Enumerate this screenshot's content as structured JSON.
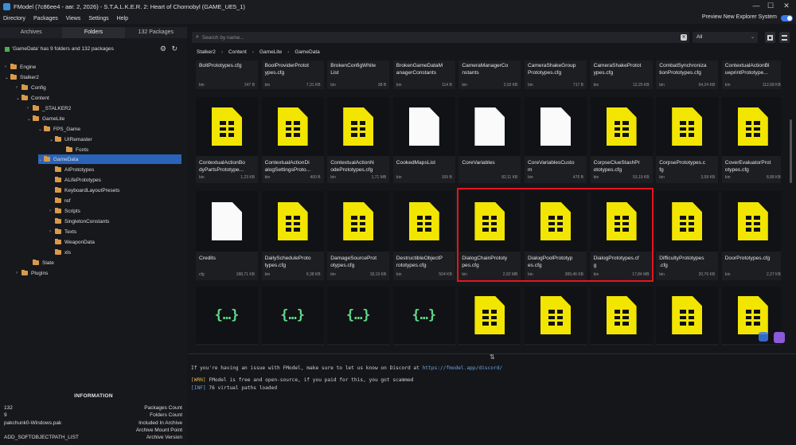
{
  "window": {
    "title": "FModel (7c86ee4 - авг. 2, 2026) - S.T.A.L.K.E.R. 2: Heart of Chornobyl (GAME_UE5_1)",
    "controls": [
      "—",
      "☐",
      "✕"
    ]
  },
  "menu": {
    "items": [
      "Directory",
      "Packages",
      "Views",
      "Settings",
      "Help"
    ],
    "preview_label": "Preview New Explorer System",
    "preview_enabled": true
  },
  "left": {
    "tabs": [
      {
        "label": "Archives",
        "active": false
      },
      {
        "label": "Folders",
        "active": true
      },
      {
        "label": "132 Packages",
        "active": false
      }
    ],
    "status": "'GameData' has 9 folders and 132 packages",
    "tree": [
      {
        "label": "Engine",
        "expanded": false
      },
      {
        "label": "Stalker2",
        "expanded": true
      },
      {
        "label": "Config",
        "expanded": false
      },
      {
        "label": "Content",
        "expanded": true
      },
      {
        "label": "_STALKER2",
        "expanded": false
      },
      {
        "label": "GameLite",
        "expanded": true
      },
      {
        "label": "FPS_Game",
        "expanded": true
      },
      {
        "label": "UIRemaster",
        "expanded": true
      },
      {
        "label": "Fonts",
        "expanded": false
      },
      {
        "label": "GameData",
        "expanded": true,
        "selected": true
      },
      {
        "label": "AIPrototypes",
        "expanded": false
      },
      {
        "label": "ALifePrototypes",
        "expanded": false
      },
      {
        "label": "KeyboardLayoutPresets",
        "expanded": false
      },
      {
        "label": "ref",
        "expanded": false
      },
      {
        "label": "Scripts",
        "expanded": false
      },
      {
        "label": "SingletonConstants",
        "expanded": false
      },
      {
        "label": "Texts",
        "expanded": false
      },
      {
        "label": "WeaponData",
        "expanded": false
      },
      {
        "label": "xls",
        "expanded": false
      },
      {
        "label": "Slate",
        "expanded": false
      },
      {
        "label": "Plugins",
        "expanded": false
      }
    ],
    "information": {
      "title": "INFORMATION",
      "values": [
        "132",
        "9",
        "pakchunk0-Windows.pak",
        "",
        "ADD_SOFTOBJECTPATH_LIST"
      ],
      "labels": [
        "Packages Count",
        "Folders Count",
        "Included In Archive",
        "Archive Mount Point",
        "Archive Version"
      ]
    }
  },
  "search": {
    "placeholder": "Search by name...",
    "filter": "All"
  },
  "breadcrumb": [
    "Stalker2",
    "Content",
    "GameLite",
    "GameData"
  ],
  "files": [
    {
      "name": "BoltPrototypes.cfg",
      "ext": "bin",
      "size": "247 B",
      "icon": "none"
    },
    {
      "name": "BoolProviderProtot\nypes.cfg",
      "ext": "bin",
      "size": "7,31 KB",
      "icon": "none"
    },
    {
      "name": "BrokenConfigWhite\nList",
      "ext": "bin",
      "size": "38 B",
      "icon": "none"
    },
    {
      "name": "BrokenGameDataM\nanagerConstants",
      "ext": "bin",
      "size": "114 B",
      "icon": "none"
    },
    {
      "name": "CameraManagerCo\nnstants",
      "ext": "bin",
      "size": "2,03 KB",
      "icon": "none"
    },
    {
      "name": "CameraShakeGroup\nPrototypes.cfg",
      "ext": "bin",
      "size": "717 B",
      "icon": "none"
    },
    {
      "name": "CameraShakeProtot\nypes.cfg",
      "ext": "bin",
      "size": "12,25 KB",
      "icon": "none"
    },
    {
      "name": "CombatSynchroniza\ntionPrototypes.cfg",
      "ext": "bin",
      "size": "64,24 KB",
      "icon": "none"
    },
    {
      "name": "ContextualActionBl\nueprintPrototype...",
      "ext": "bin",
      "size": "112,68 KB",
      "icon": "none"
    },
    {
      "name": "ContextualActionBo\ndyPartsPrototype...",
      "ext": "bin",
      "size": "1,23 KB",
      "icon": "yellow"
    },
    {
      "name": "ContextualActionDi\nalogSettingsProto...",
      "ext": "bin",
      "size": "400 B",
      "icon": "yellow"
    },
    {
      "name": "ContextualActionN\nodePrototypes.cfg",
      "ext": "bin",
      "size": "1,71 MB",
      "icon": "yellow"
    },
    {
      "name": "CookedMapsList",
      "ext": "bin",
      "size": "109 B",
      "icon": "white"
    },
    {
      "name": "CoreVariables",
      "ext": "",
      "size": "82,11 KB",
      "icon": "white"
    },
    {
      "name": "CoreVariablesCusto\nm",
      "ext": "bin",
      "size": "476 B",
      "icon": "white"
    },
    {
      "name": "CorpseClueStashPr\nototypes.cfg",
      "ext": "bin",
      "size": "53,19 KB",
      "icon": "yellow"
    },
    {
      "name": "CorpsePrototypes.c\nfg",
      "ext": "bin",
      "size": "3,58 KB",
      "icon": "yellow"
    },
    {
      "name": "CoverEvaluatorProt\notypes.cfg",
      "ext": "bin",
      "size": "8,88 KB",
      "icon": "yellow"
    },
    {
      "name": "Credits",
      "ext": "cfg",
      "size": "188,71 KB",
      "icon": "white"
    },
    {
      "name": "DailyScheduleProto\ntypes.cfg",
      "ext": "bin",
      "size": "9,38 KB",
      "icon": "yellow"
    },
    {
      "name": "DamageSourceProt\notypes.cfg",
      "ext": "bin",
      "size": "18,19 KB",
      "icon": "yellow"
    },
    {
      "name": "DestructibleObjectP\nrototypes.cfg",
      "ext": "bin",
      "size": "504 KB",
      "icon": "yellow"
    },
    {
      "name": "DialogChainPrototy\npes.cfg",
      "ext": "bin",
      "size": "2,92 MB",
      "icon": "yellow"
    },
    {
      "name": "DialogPoolPrototyp\nes.cfg",
      "ext": "bin",
      "size": "389,46 KB",
      "icon": "yellow"
    },
    {
      "name": "DialogPrototypes.cf\ng",
      "ext": "bin",
      "size": "17,84 MB",
      "icon": "yellow"
    },
    {
      "name": "DifficultyPrototypes\n.cfg",
      "ext": "bin",
      "size": "20,76 KB",
      "icon": "yellow"
    },
    {
      "name": "DoorPrototypes.cfg",
      "ext": "bin",
      "size": "2,27 KB",
      "icon": "yellow"
    },
    {
      "name": "",
      "ext": "",
      "size": "",
      "icon": "json"
    },
    {
      "name": "",
      "ext": "",
      "size": "",
      "icon": "json"
    },
    {
      "name": "",
      "ext": "",
      "size": "",
      "icon": "json"
    },
    {
      "name": "",
      "ext": "",
      "size": "",
      "icon": "json"
    },
    {
      "name": "",
      "ext": "",
      "size": "",
      "icon": "yellow"
    },
    {
      "name": "",
      "ext": "",
      "size": "",
      "icon": "yellow"
    },
    {
      "name": "",
      "ext": "",
      "size": "",
      "icon": "yellow"
    },
    {
      "name": "",
      "ext": "",
      "size": "",
      "icon": "yellow"
    },
    {
      "name": "",
      "ext": "",
      "size": "",
      "icon": "yellow"
    }
  ],
  "console": {
    "line1_prefix": "If you're having an issue with FModel, make sure to let us know on Discord at ",
    "line1_link": "https://fmodel.app/discord/",
    "warn_tag": "[WRN]",
    "warn_text": " FModel is free and open-source, if you paid for this, you got scammed",
    "inf_tag": "[INF]",
    "inf_text": " 76 virtual paths loaded"
  },
  "colors": {
    "accent": "#2a63b8",
    "doc_yellow": "#f2e600",
    "highlight": "#e8141e",
    "json_green": "#5fd88c"
  },
  "icons": [
    "search-icon",
    "clear-icon",
    "grid-view-icon",
    "list-view-icon",
    "folder-icon",
    "document-icon",
    "json-icon",
    "settings-icon",
    "refresh-icon"
  ]
}
